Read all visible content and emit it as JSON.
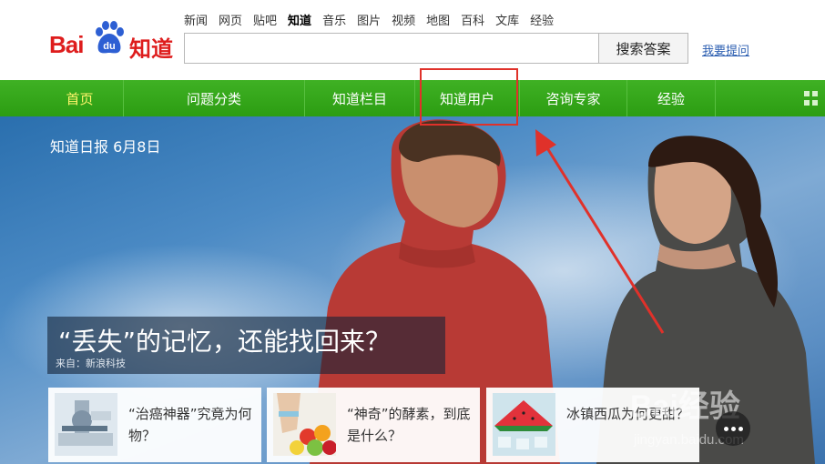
{
  "logo": {
    "left_text": "Bai",
    "paw_text": "du",
    "right_text": "知道"
  },
  "topnav": [
    "新闻",
    "网页",
    "贴吧",
    "知道",
    "音乐",
    "图片",
    "视频",
    "地图",
    "百科",
    "文库",
    "经验"
  ],
  "topnav_active": "知道",
  "search": {
    "placeholder": "",
    "value": "",
    "button_label": "搜索答案",
    "ask_link": "我要提问"
  },
  "mainnav": [
    "首页",
    "问题分类",
    "知道栏目",
    "知道用户",
    "咨询专家",
    "经验"
  ],
  "hero": {
    "daily_label": "知道日报 6月8日",
    "headline": "“丢失”的记忆，还能找回来？",
    "source": "来自：新浪科技"
  },
  "cards": [
    {
      "text": "“治癌神器”究竟为何物？",
      "icon": "medical-machine-image"
    },
    {
      "text": "“神奇”的酵素，到底是什么？",
      "icon": "fruit-image"
    },
    {
      "text": "冰镇西瓜为何更甜？",
      "icon": "watermelon-image"
    }
  ],
  "watermark": {
    "brand": "Bai经验",
    "url": "jingyan.baidu.com"
  },
  "colors": {
    "brand_red": "#de1d1d",
    "nav_green": "#34a61a",
    "highlight_red": "#e0312a",
    "link_blue": "#2a5db0"
  }
}
